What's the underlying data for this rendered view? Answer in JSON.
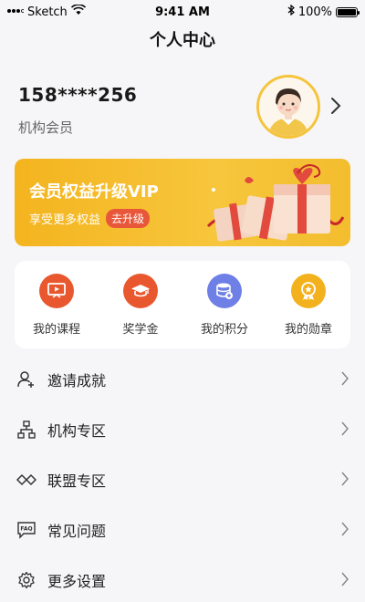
{
  "status_bar": {
    "carrier": "Sketch",
    "time": "9:41 AM",
    "battery": "100%"
  },
  "page_title": "个人中心",
  "profile": {
    "phone": "158****256",
    "member_type": "机构会员"
  },
  "banner": {
    "title": "会员权益升级VIP",
    "subtitle": "享受更多权益",
    "button": "去升级"
  },
  "quick_actions": [
    {
      "label": "我的课程",
      "icon": "course-icon",
      "color": "#e9572f"
    },
    {
      "label": "奖学金",
      "icon": "scholarship-icon",
      "color": "#e9572f"
    },
    {
      "label": "我的积分",
      "icon": "points-icon",
      "color": "#6e7fe6"
    },
    {
      "label": "我的勋章",
      "icon": "medal-icon",
      "color": "#f3b21d"
    }
  ],
  "menu": [
    {
      "label": "邀请成就",
      "icon": "invite-user-icon"
    },
    {
      "label": "机构专区",
      "icon": "organization-icon"
    },
    {
      "label": "联盟专区",
      "icon": "alliance-icon"
    },
    {
      "label": "常见问题",
      "icon": "faq-icon"
    },
    {
      "label": "更多设置",
      "icon": "settings-gear-icon"
    }
  ],
  "colors": {
    "banner_yellow": "#f4b41f",
    "upgrade_red": "#e8573a",
    "page_bg": "#f6f6f8"
  }
}
